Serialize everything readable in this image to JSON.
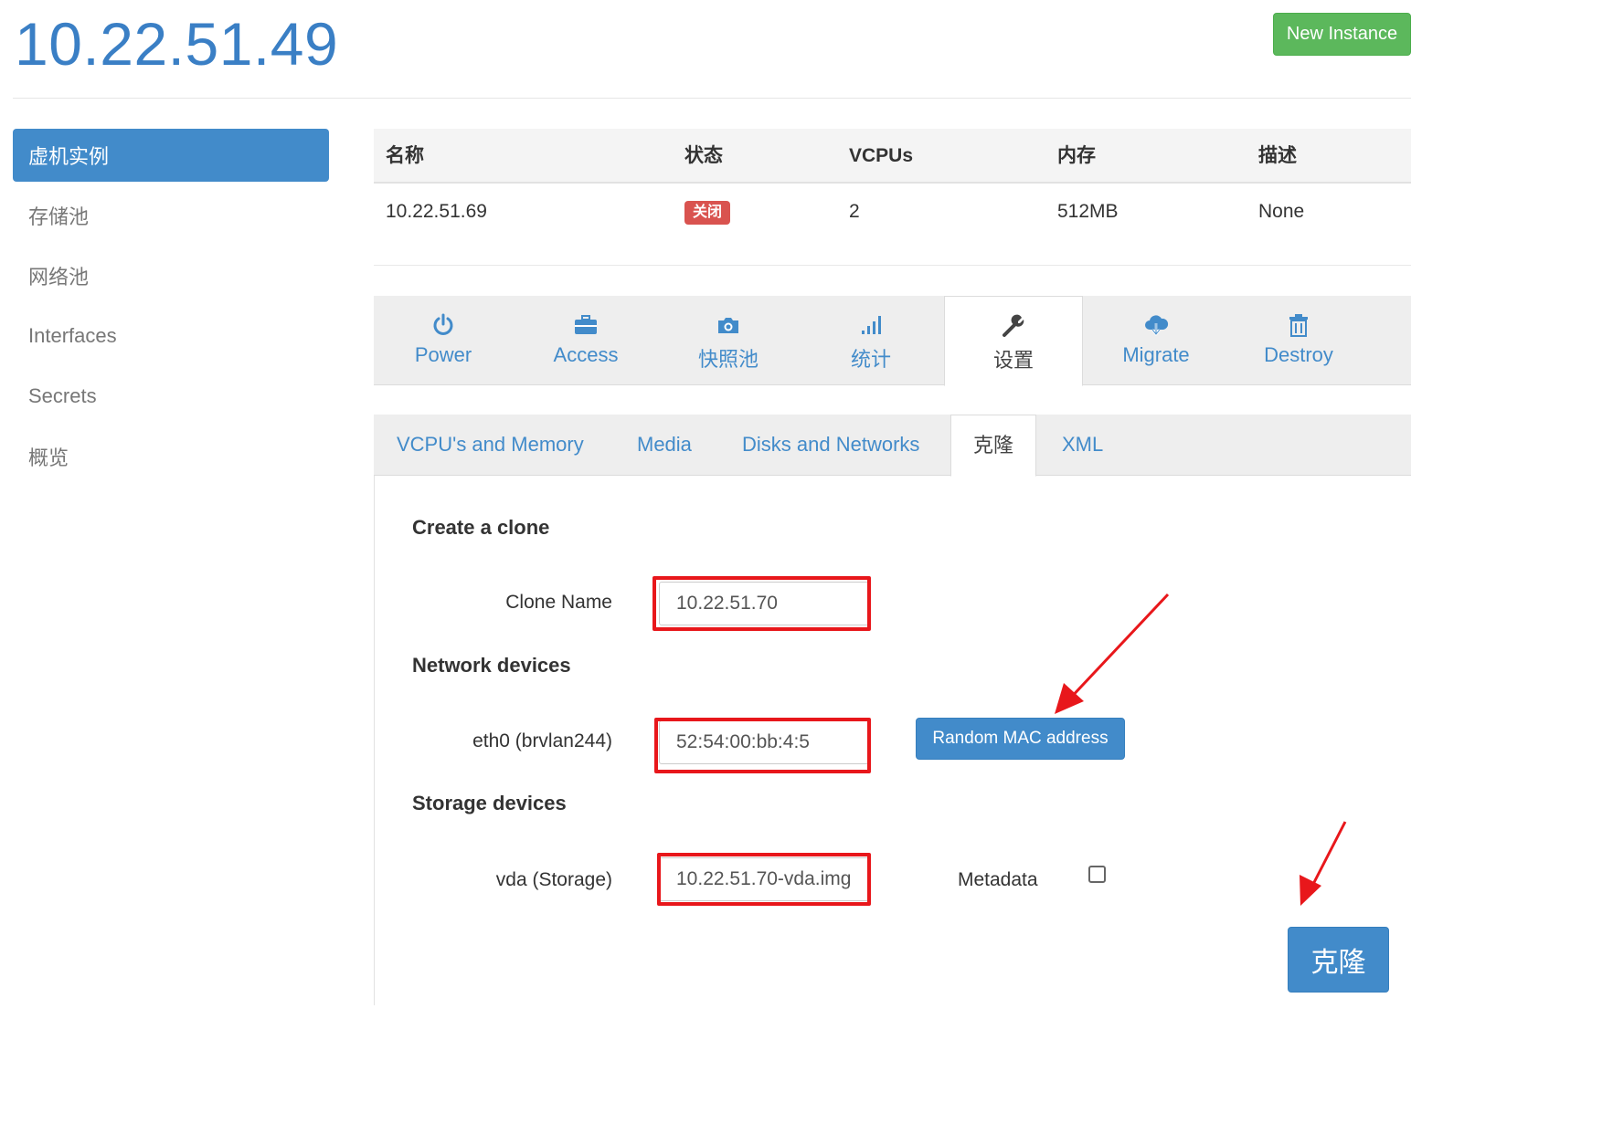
{
  "header": {
    "title": "10.22.51.49",
    "new_instance_label": "New Instance"
  },
  "sidebar": {
    "items": [
      {
        "label": "虚机实例",
        "active": true
      },
      {
        "label": "存储池",
        "active": false
      },
      {
        "label": "网络池",
        "active": false
      },
      {
        "label": "Interfaces",
        "active": false
      },
      {
        "label": "Secrets",
        "active": false
      },
      {
        "label": "概览",
        "active": false
      }
    ]
  },
  "instance_table": {
    "headers": [
      "名称",
      "状态",
      "VCPUs",
      "内存",
      "描述"
    ],
    "row": {
      "name": "10.22.51.69",
      "status": "关闭",
      "vcpus": "2",
      "memory": "512MB",
      "description": "None"
    },
    "status_color": "#d9534f"
  },
  "main_tabs": [
    {
      "label": "Power",
      "icon": "power-icon"
    },
    {
      "label": "Access",
      "icon": "briefcase-icon"
    },
    {
      "label": "快照池",
      "icon": "camera-icon"
    },
    {
      "label": "统计",
      "icon": "signal-icon"
    },
    {
      "label": "设置",
      "icon": "wrench-icon",
      "active": true
    },
    {
      "label": "Migrate",
      "icon": "cloud-download-icon"
    },
    {
      "label": "Destroy",
      "icon": "trash-icon"
    }
  ],
  "settings_tabs": [
    {
      "label": "VCPU's and Memory"
    },
    {
      "label": "Media"
    },
    {
      "label": "Disks and Networks"
    },
    {
      "label": "克隆",
      "active": true
    },
    {
      "label": "XML"
    }
  ],
  "clone_form": {
    "create_title": "Create a clone",
    "clone_name_label": "Clone Name",
    "clone_name_value": "10.22.51.70",
    "network_title": "Network devices",
    "eth_label": "eth0 (brvlan244)",
    "eth_value": "52:54:00:bb:4:5",
    "random_mac_label": "Random MAC address",
    "storage_title": "Storage devices",
    "vda_label": "vda (Storage)",
    "vda_value": "10.22.51.70-vda.img",
    "metadata_label": "Metadata",
    "metadata_checked": false,
    "clone_button_label": "克隆"
  },
  "colors": {
    "accent": "#428bca",
    "success": "#5cb85c",
    "danger": "#d9534f",
    "highlight": "#e8171b"
  }
}
